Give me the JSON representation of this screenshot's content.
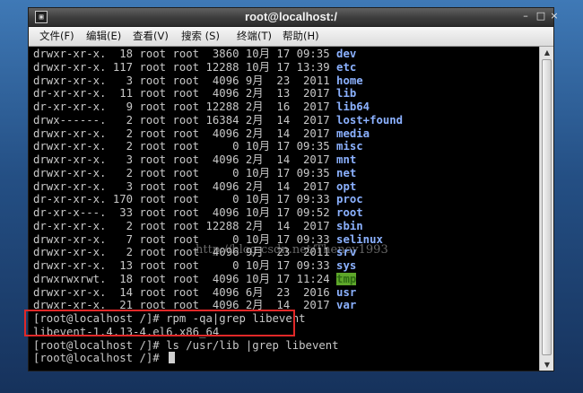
{
  "window": {
    "title": "root@localhost:/",
    "app_icon_glyph": "▣",
    "controls": {
      "minimize": "–",
      "maximize": "□",
      "close": "×"
    }
  },
  "menu": [
    "文件(F)",
    "编辑(E)",
    "查看(V)",
    "搜索 (S)",
    "终端(T)",
    "帮助(H)"
  ],
  "listing": [
    {
      "perm": "drwxr-xr-x.",
      "links": "18",
      "owner": "root",
      "group": "root",
      "size": "3860",
      "month": "10月",
      "day": "17",
      "time": "09:35",
      "name": "dev"
    },
    {
      "perm": "drwxr-xr-x.",
      "links": "117",
      "owner": "root",
      "group": "root",
      "size": "12288",
      "month": "10月",
      "day": "17",
      "time": "13:39",
      "name": "etc"
    },
    {
      "perm": "drwxr-xr-x.",
      "links": "3",
      "owner": "root",
      "group": "root",
      "size": "4096",
      "month": "9月",
      "day": "23",
      "time": "2011",
      "name": "home"
    },
    {
      "perm": "dr-xr-xr-x.",
      "links": "11",
      "owner": "root",
      "group": "root",
      "size": "4096",
      "month": "2月",
      "day": "13",
      "time": "2017",
      "name": "lib"
    },
    {
      "perm": "dr-xr-xr-x.",
      "links": "9",
      "owner": "root",
      "group": "root",
      "size": "12288",
      "month": "2月",
      "day": "16",
      "time": "2017",
      "name": "lib64"
    },
    {
      "perm": "drwx------.",
      "links": "2",
      "owner": "root",
      "group": "root",
      "size": "16384",
      "month": "2月",
      "day": "14",
      "time": "2017",
      "name": "lost+found"
    },
    {
      "perm": "drwxr-xr-x.",
      "links": "2",
      "owner": "root",
      "group": "root",
      "size": "4096",
      "month": "2月",
      "day": "14",
      "time": "2017",
      "name": "media"
    },
    {
      "perm": "drwxr-xr-x.",
      "links": "2",
      "owner": "root",
      "group": "root",
      "size": "0",
      "month": "10月",
      "day": "17",
      "time": "09:35",
      "name": "misc"
    },
    {
      "perm": "drwxr-xr-x.",
      "links": "3",
      "owner": "root",
      "group": "root",
      "size": "4096",
      "month": "2月",
      "day": "14",
      "time": "2017",
      "name": "mnt"
    },
    {
      "perm": "drwxr-xr-x.",
      "links": "2",
      "owner": "root",
      "group": "root",
      "size": "0",
      "month": "10月",
      "day": "17",
      "time": "09:35",
      "name": "net"
    },
    {
      "perm": "drwxr-xr-x.",
      "links": "3",
      "owner": "root",
      "group": "root",
      "size": "4096",
      "month": "2月",
      "day": "14",
      "time": "2017",
      "name": "opt"
    },
    {
      "perm": "dr-xr-xr-x.",
      "links": "170",
      "owner": "root",
      "group": "root",
      "size": "0",
      "month": "10月",
      "day": "17",
      "time": "09:33",
      "name": "proc"
    },
    {
      "perm": "dr-xr-x---.",
      "links": "33",
      "owner": "root",
      "group": "root",
      "size": "4096",
      "month": "10月",
      "day": "17",
      "time": "09:52",
      "name": "root"
    },
    {
      "perm": "dr-xr-xr-x.",
      "links": "2",
      "owner": "root",
      "group": "root",
      "size": "12288",
      "month": "2月",
      "day": "14",
      "time": "2017",
      "name": "sbin"
    },
    {
      "perm": "drwxr-xr-x.",
      "links": "7",
      "owner": "root",
      "group": "root",
      "size": "0",
      "month": "10月",
      "day": "17",
      "time": "09:33",
      "name": "selinux"
    },
    {
      "perm": "drwxr-xr-x.",
      "links": "2",
      "owner": "root",
      "group": "root",
      "size": "4096",
      "month": "9月",
      "day": "23",
      "time": "2011",
      "name": "srv"
    },
    {
      "perm": "drwxr-xr-x.",
      "links": "13",
      "owner": "root",
      "group": "root",
      "size": "0",
      "month": "10月",
      "day": "17",
      "time": "09:33",
      "name": "sys"
    },
    {
      "perm": "drwxrwxrwt.",
      "links": "18",
      "owner": "root",
      "group": "root",
      "size": "4096",
      "month": "10月",
      "day": "17",
      "time": "11:24",
      "name": "tmp",
      "sticky": true
    },
    {
      "perm": "drwxr-xr-x.",
      "links": "14",
      "owner": "root",
      "group": "root",
      "size": "4096",
      "month": "6月",
      "day": "23",
      "time": "2016",
      "name": "usr"
    },
    {
      "perm": "drwxr-xr-x.",
      "links": "21",
      "owner": "root",
      "group": "root",
      "size": "4096",
      "month": "2月",
      "day": "14",
      "time": "2017",
      "name": "var"
    }
  ],
  "commands": [
    {
      "text": "[root@localhost /]# rpm -qa|grep libevent"
    },
    {
      "text": "libevent-1.4.13-4.el6.x86_64"
    },
    {
      "text": "[root@localhost /]# ls /usr/lib |grep libevent"
    },
    {
      "text": "[root@localhost /]# ",
      "cursor": true
    }
  ],
  "watermark": "http://blog.csdn.net/Theney1993",
  "colors": {
    "directory": "#8bb1ff",
    "sticky_dir_bg": "#5ea62a",
    "highlight_box": "#e02828",
    "terminal_bg": "#000000"
  }
}
